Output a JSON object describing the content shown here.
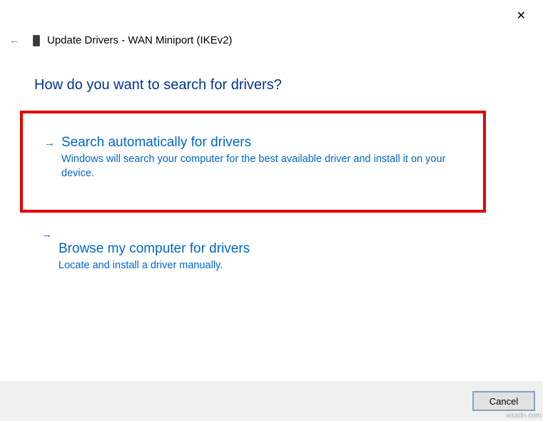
{
  "header": {
    "title_prefix": "Update Drivers - ",
    "device_name": "WAN Miniport (IKEv2)"
  },
  "question": "How do you want to search for drivers?",
  "options": [
    {
      "title": "Search automatically for drivers",
      "description": "Windows will search your computer for the best available driver and install it on your device."
    },
    {
      "title": "Browse my computer for drivers",
      "description": "Locate and install a driver manually."
    }
  ],
  "buttons": {
    "cancel": "Cancel"
  },
  "watermark": "wsxdn.com"
}
